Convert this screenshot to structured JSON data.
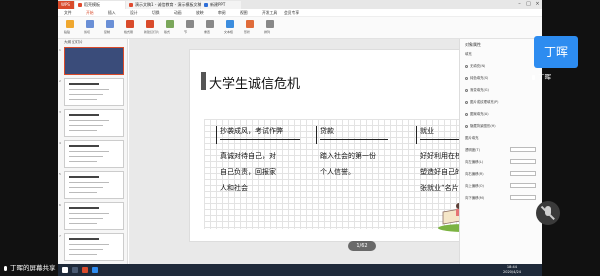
{
  "wps": {
    "tabs": {
      "home": "WPS",
      "doc1": "稻壳模板",
      "doc2": "演示文稿1 - 诚信教育 - 演示模板文稿",
      "doc3": "新建PPT"
    },
    "menus": [
      "文件",
      "开始",
      "插入",
      "设计",
      "切换",
      "动画",
      "放映",
      "审阅",
      "视图",
      "开发工具",
      "会员专享"
    ],
    "active_menu": "开始",
    "ribbon_labels": [
      "粘贴",
      "剪切",
      "复制",
      "格式刷",
      "新建幻灯片",
      "版式",
      "节",
      "重置",
      "文本框",
      "形状",
      "排列"
    ],
    "thumbnails": {
      "tabs": "大纲  幻灯片",
      "items": [
        "1",
        "2",
        "3",
        "4",
        "5",
        "6",
        "7"
      ]
    },
    "slide": {
      "title": "大学生诚信危机",
      "calligraphy_1": "诚",
      "calligraphy_2": "信",
      "columns": [
        {
          "head": "抄袭成风，考试作弊",
          "lines": [
            "真诚对待自己，对",
            "自己负责，回报家",
            "人和社会"
          ]
        },
        {
          "head": "贷款",
          "lines": [
            "踏入社会的第一份",
            "个人信誉。"
          ]
        },
        {
          "head": "就业",
          "lines": [
            "好好利用在校时光，",
            "塑造好自己的第一",
            "张就业“名片”。"
          ]
        }
      ]
    },
    "page_indicator": "1/62",
    "status": {
      "left": "幻灯片 1 / 62",
      "notes": "单击此处添加备注"
    },
    "right_panel": {
      "title": "对象属性",
      "rows": [
        "填充",
        "无填充(N)",
        "纯色填充(S)",
        "渐变填充(G)",
        "图片或纹理填充(P)",
        "图案填充(A)",
        "隐藏背景图形(H)",
        "图片填充",
        "透明度(T)",
        "向左偏移(L)",
        "向右偏移(R)",
        "向上偏移(O)",
        "向下偏移(M)"
      ]
    }
  },
  "meeting": {
    "avatar_text": "丁晖",
    "participant_name": "丁晖",
    "share_label": "丁晖的屏幕共享"
  },
  "taskbar": {
    "time": "18:44",
    "date": "2020/4/24"
  },
  "colors": {
    "accent": "#d94b2b",
    "avatar_bg": "#2d8cf0",
    "taskbar": "#1f2a3a"
  }
}
